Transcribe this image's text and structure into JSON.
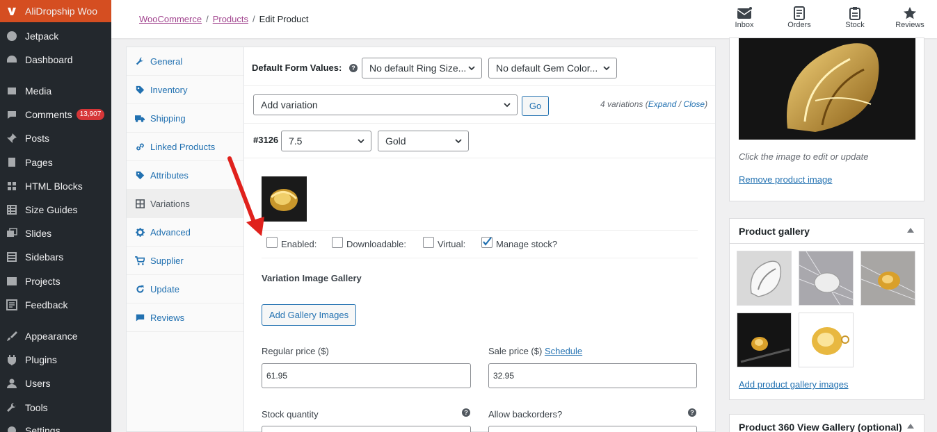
{
  "sidebar": {
    "items": [
      {
        "label": "AliDropship Woo",
        "icon": "alidropship-icon"
      },
      {
        "label": "Jetpack",
        "icon": "jetpack-icon"
      },
      {
        "label": "Dashboard",
        "icon": "dashboard-icon"
      },
      {
        "label": "Media",
        "icon": "media-icon"
      },
      {
        "label": "Comments",
        "icon": "comments-icon",
        "count": "13,907"
      },
      {
        "label": "Posts",
        "icon": "pin-icon"
      },
      {
        "label": "Pages",
        "icon": "pages-icon"
      },
      {
        "label": "HTML Blocks",
        "icon": "grid-icon"
      },
      {
        "label": "Size Guides",
        "icon": "table-icon"
      },
      {
        "label": "Slides",
        "icon": "slides-icon"
      },
      {
        "label": "Sidebars",
        "icon": "list-icon"
      },
      {
        "label": "Projects",
        "icon": "portfolio-icon"
      },
      {
        "label": "Feedback",
        "icon": "feedback-icon"
      },
      {
        "label": "Appearance",
        "icon": "brush-icon"
      },
      {
        "label": "Plugins",
        "icon": "plugin-icon"
      },
      {
        "label": "Users",
        "icon": "user-icon"
      },
      {
        "label": "Tools",
        "icon": "wrench-icon"
      },
      {
        "label": "Settings",
        "icon": "settings-icon"
      }
    ]
  },
  "breadcrumb": {
    "woocommerce": "WooCommerce",
    "products": "Products",
    "current": "Edit Product",
    "sep": "/"
  },
  "toolbar": {
    "inbox": "Inbox",
    "orders": "Orders",
    "stock": "Stock",
    "reviews": "Reviews"
  },
  "tabs": [
    {
      "label": "General",
      "icon": "wrench-icon"
    },
    {
      "label": "Inventory",
      "icon": "tag-icon"
    },
    {
      "label": "Shipping",
      "icon": "truck-icon"
    },
    {
      "label": "Linked Products",
      "icon": "link-icon"
    },
    {
      "label": "Attributes",
      "icon": "tag-icon"
    },
    {
      "label": "Variations",
      "icon": "grid-icon",
      "active": true
    },
    {
      "label": "Advanced",
      "icon": "gear-icon"
    },
    {
      "label": "Supplier",
      "icon": "cart-icon"
    },
    {
      "label": "Update",
      "icon": "refresh-icon"
    },
    {
      "label": "Reviews",
      "icon": "comments-icon"
    }
  ],
  "variations": {
    "default_label": "Default Form Values:",
    "ring_size": "No default Ring Size...",
    "gem_color": "No default Gem Color...",
    "add_variation": "Add variation",
    "go": "Go",
    "count_text": "4 variations (",
    "expand": "Expand",
    "slash": " / ",
    "close": "Close",
    "close_paren": ")",
    "var_id": "#3126",
    "size_value": "7.5",
    "color_value": "Gold",
    "enabled": "Enabled:",
    "downloadable": "Downloadable:",
    "virtual": "Virtual:",
    "manage_stock": "Manage stock?",
    "gallery_title": "Variation Image Gallery",
    "add_gallery": "Add Gallery Images",
    "regular_label": "Regular price ($)",
    "regular_value": "61.95",
    "sale_label": "Sale price ($)",
    "schedule": "Schedule",
    "sale_value": "32.95",
    "stock_qty": "Stock quantity",
    "backorders": "Allow backorders?",
    "manage_checked": true
  },
  "right": {
    "image_hint": "Click the image to edit or update",
    "remove_image": "Remove product image",
    "gallery_title": "Product gallery",
    "add_gallery_link": "Add product gallery images",
    "gallery360_title": "Product 360 View Gallery (optional)"
  },
  "colors": {
    "accent": "#2271b1",
    "sidebar": "#23282d",
    "active_menu": "#d54e21",
    "annotation_arrow": "#e0211c"
  }
}
